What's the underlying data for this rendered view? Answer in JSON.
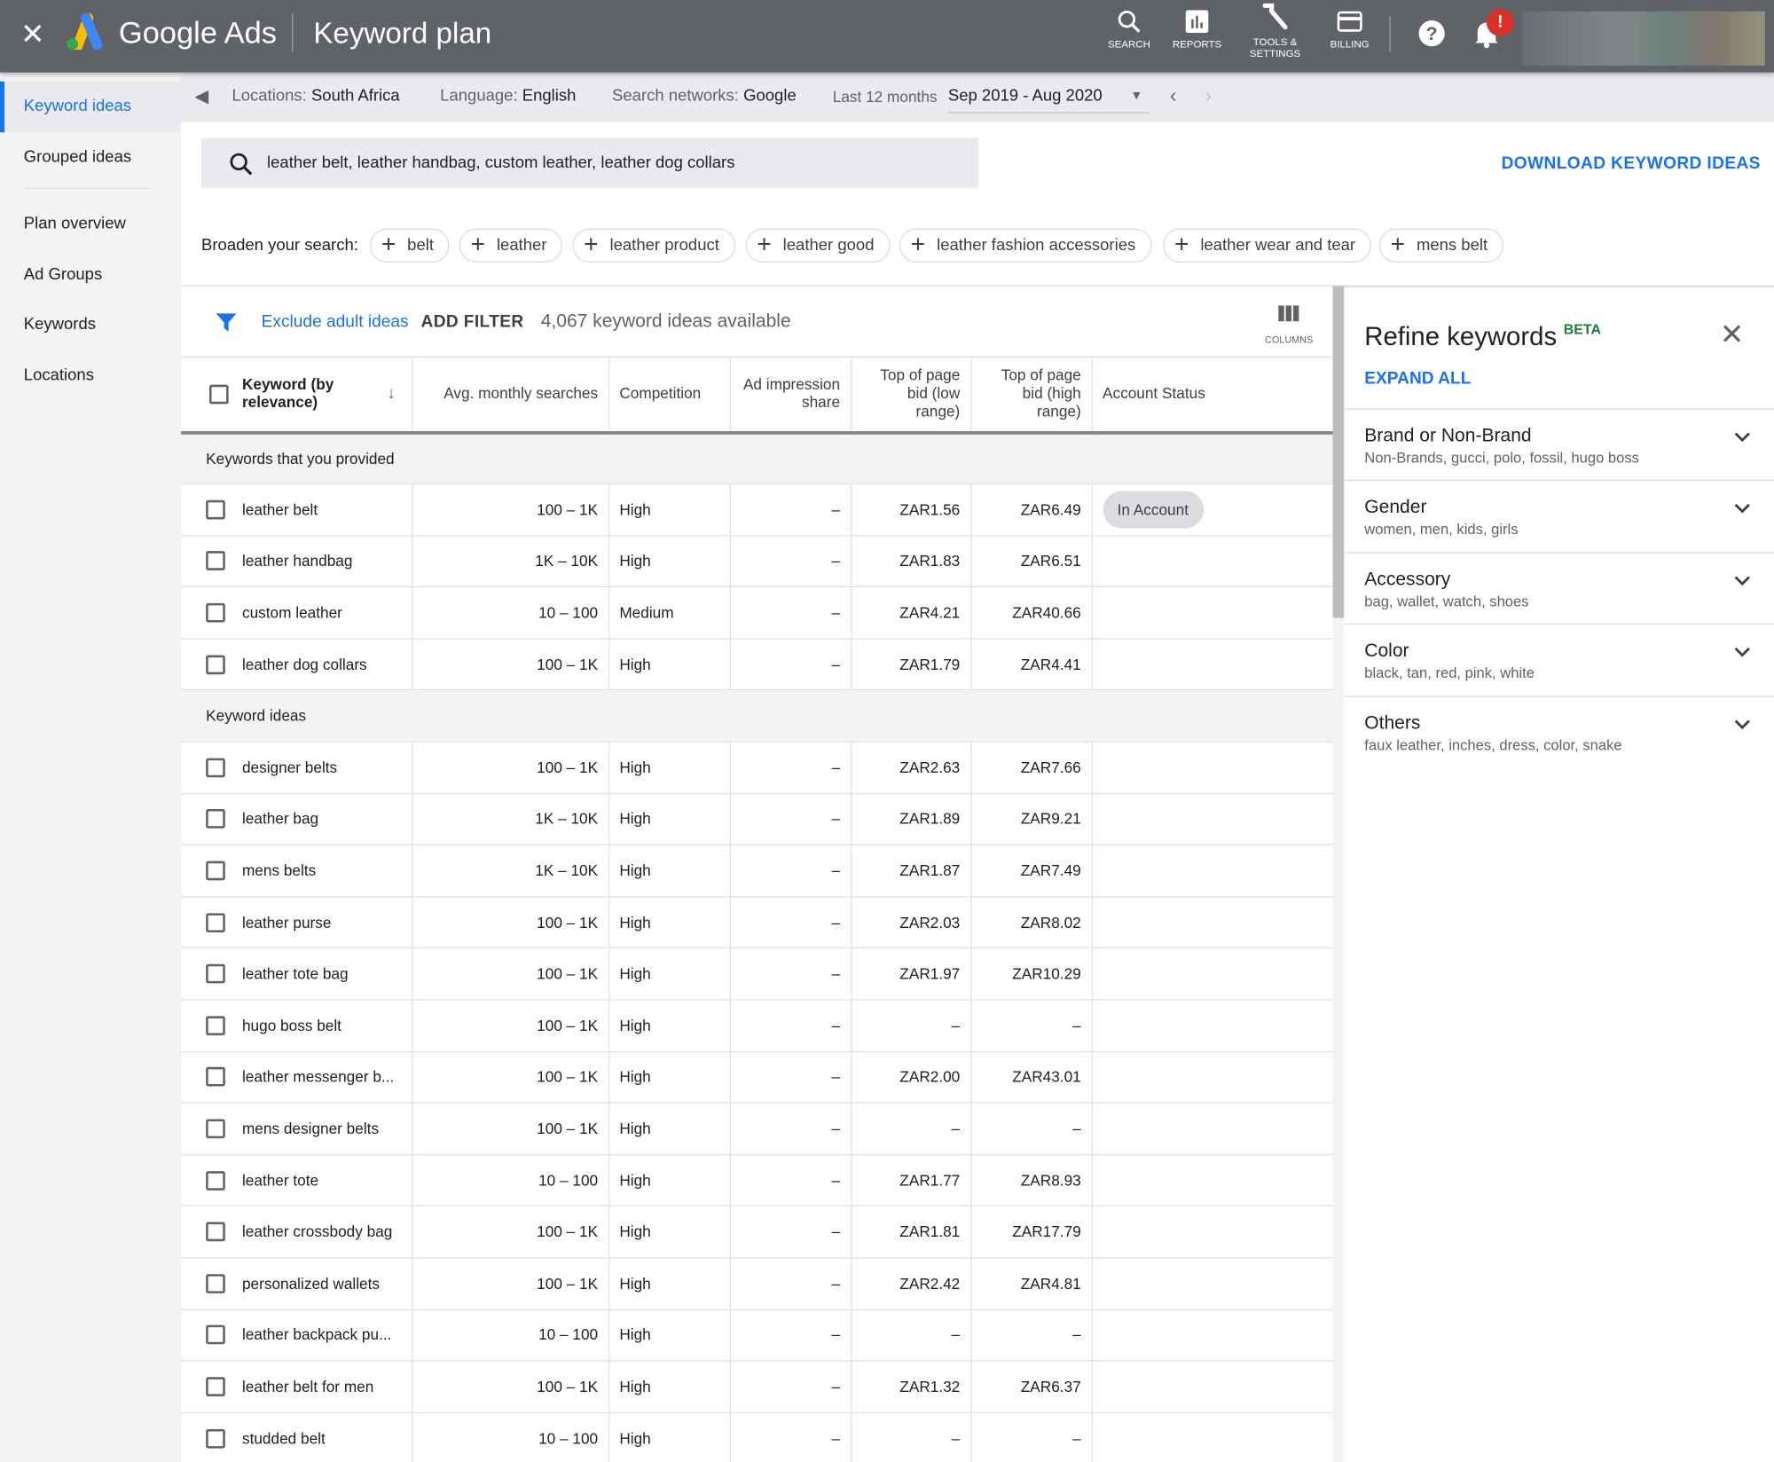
{
  "header": {
    "close_icon": "close-icon",
    "brand": "Google Ads",
    "title": "Keyword plan",
    "nav": [
      {
        "icon": "search-icon",
        "label": "SEARCH"
      },
      {
        "icon": "reports-icon",
        "label": "REPORTS"
      },
      {
        "icon": "wrench-icon",
        "label": "TOOLS &\nSETTINGS"
      },
      {
        "icon": "billing-icon",
        "label": "BILLING"
      }
    ],
    "notification_badge": "!",
    "brand_colors": {
      "blue": "#4285f4",
      "yellow": "#fbbc04",
      "green": "#34a853"
    }
  },
  "sidebar": {
    "items": [
      {
        "label": "Keyword ideas",
        "selected": true
      },
      {
        "label": "Grouped ideas"
      },
      {
        "label": "Plan overview"
      },
      {
        "label": "Ad Groups"
      },
      {
        "label": "Keywords"
      },
      {
        "label": "Locations"
      }
    ]
  },
  "filters": {
    "locations_label": "Locations:",
    "locations": "South Africa",
    "language_label": "Language:",
    "language": "English",
    "networks_label": "Search networks:",
    "networks": "Google",
    "range_label": "Last 12 months",
    "range": "Sep 2019 - Aug 2020"
  },
  "search": {
    "query": "leather belt, leather handbag, custom leather, leather dog collars",
    "download": "DOWNLOAD KEYWORD IDEAS"
  },
  "broaden": {
    "label": "Broaden your search:",
    "chips": [
      "belt",
      "leather",
      "leather product",
      "leather good",
      "leather fashion accessories",
      "leather wear and tear",
      "mens belt"
    ]
  },
  "toolbar": {
    "exclude": "Exclude adult ideas",
    "add_filter": "ADD FILTER",
    "count": "4,067 keyword ideas available",
    "columns": "COLUMNS"
  },
  "table": {
    "headers": [
      "Keyword (by relevance)",
      "Avg. monthly searches",
      "Competition",
      "Ad impression share",
      "Top of page bid (low range)",
      "Top of page bid (high range)",
      "Account Status"
    ],
    "groups": [
      {
        "label": "Keywords that you provided",
        "rows": [
          [
            "leather belt",
            "100 – 1K",
            "High",
            "–",
            "ZAR1.56",
            "ZAR6.49",
            "In Account"
          ],
          [
            "leather handbag",
            "1K – 10K",
            "High",
            "–",
            "ZAR1.83",
            "ZAR6.51",
            ""
          ],
          [
            "custom leather",
            "10 – 100",
            "Medium",
            "–",
            "ZAR4.21",
            "ZAR40.66",
            ""
          ],
          [
            "leather dog collars",
            "100 – 1K",
            "High",
            "–",
            "ZAR1.79",
            "ZAR4.41",
            ""
          ]
        ]
      },
      {
        "label": "Keyword ideas",
        "rows": [
          [
            "designer belts",
            "100 – 1K",
            "High",
            "–",
            "ZAR2.63",
            "ZAR7.66",
            ""
          ],
          [
            "leather bag",
            "1K – 10K",
            "High",
            "–",
            "ZAR1.89",
            "ZAR9.21",
            ""
          ],
          [
            "mens belts",
            "1K – 10K",
            "High",
            "–",
            "ZAR1.87",
            "ZAR7.49",
            ""
          ],
          [
            "leather purse",
            "100 – 1K",
            "High",
            "–",
            "ZAR2.03",
            "ZAR8.02",
            ""
          ],
          [
            "leather tote bag",
            "100 – 1K",
            "High",
            "–",
            "ZAR1.97",
            "ZAR10.29",
            ""
          ],
          [
            "hugo boss belt",
            "100 – 1K",
            "High",
            "–",
            "–",
            "–",
            ""
          ],
          [
            "leather messenger b...",
            "100 – 1K",
            "High",
            "–",
            "ZAR2.00",
            "ZAR43.01",
            ""
          ],
          [
            "mens designer belts",
            "100 – 1K",
            "High",
            "–",
            "–",
            "–",
            ""
          ],
          [
            "leather tote",
            "10 – 100",
            "High",
            "–",
            "ZAR1.77",
            "ZAR8.93",
            ""
          ],
          [
            "leather crossbody bag",
            "100 – 1K",
            "High",
            "–",
            "ZAR1.81",
            "ZAR17.79",
            ""
          ],
          [
            "personalized wallets",
            "100 – 1K",
            "High",
            "–",
            "ZAR2.42",
            "ZAR4.81",
            ""
          ],
          [
            "leather backpack pu...",
            "10 – 100",
            "High",
            "–",
            "–",
            "–",
            ""
          ],
          [
            "leather belt for men",
            "100 – 1K",
            "High",
            "–",
            "ZAR1.32",
            "ZAR6.37",
            ""
          ],
          [
            "studded belt",
            "10 – 100",
            "High",
            "–",
            "–",
            "–",
            ""
          ]
        ]
      }
    ]
  },
  "refine": {
    "title": "Refine keywords",
    "badge": "BETA",
    "expand_all": "EXPAND ALL",
    "sections": [
      {
        "name": "Brand or Non-Brand",
        "sub": "Non-Brands, gucci, polo, fossil, hugo boss"
      },
      {
        "name": "Gender",
        "sub": "women, men, kids, girls"
      },
      {
        "name": "Accessory",
        "sub": "bag, wallet, watch, shoes"
      },
      {
        "name": "Color",
        "sub": "black, tan, red, pink, white"
      },
      {
        "name": "Others",
        "sub": "faux leather, inches, dress, color, snake"
      }
    ]
  }
}
